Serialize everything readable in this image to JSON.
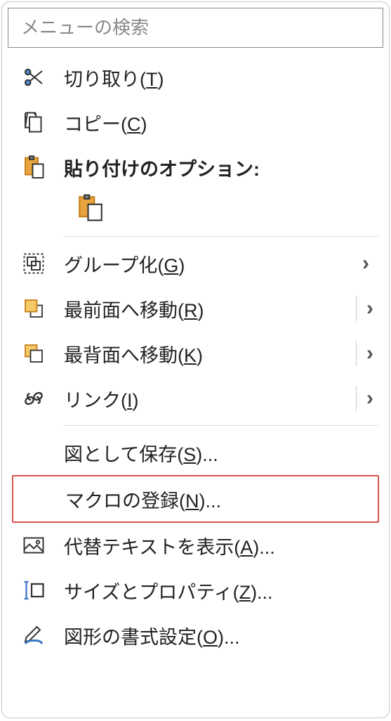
{
  "search": {
    "placeholder": "メニューの検索"
  },
  "items": {
    "cut": {
      "pre": "切り取り(",
      "key": "T",
      "post": ")"
    },
    "copy": {
      "pre": "コピー(",
      "key": "C",
      "post": ")"
    },
    "pasteOptions": {
      "label": "貼り付けのオプション:"
    },
    "group": {
      "pre": "グループ化(",
      "key": "G",
      "post": ")"
    },
    "bringFront": {
      "pre": "最前面へ移動(",
      "key": "R",
      "post": ")"
    },
    "sendBack": {
      "pre": "最背面へ移動(",
      "key": "K",
      "post": ")"
    },
    "link": {
      "pre": "リンク(",
      "key": "I",
      "post": ")"
    },
    "savePic": {
      "pre": "図として保存(",
      "key": "S",
      "post": ")..."
    },
    "assignMacro": {
      "pre": "マクロの登録(",
      "key": "N",
      "post": ")..."
    },
    "altText": {
      "pre": "代替テキストを表示(",
      "key": "A",
      "post": ")..."
    },
    "sizeProp": {
      "pre": "サイズとプロパティ(",
      "key": "Z",
      "post": ")..."
    },
    "formatShape": {
      "pre": "図形の書式設定(",
      "key": "O",
      "post": ")..."
    }
  }
}
